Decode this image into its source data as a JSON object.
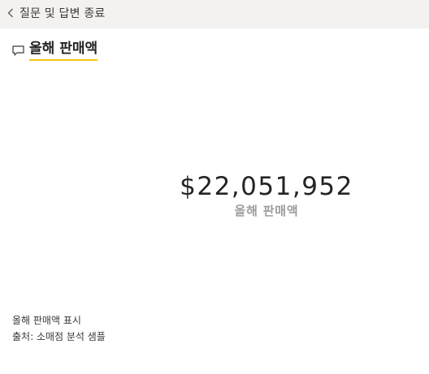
{
  "header": {
    "back_label": "질문 및 답변 종료"
  },
  "question": {
    "text": "올해 판매액"
  },
  "card": {
    "value": "$22,051,952",
    "label": "올해 판매액"
  },
  "footer": {
    "showing": "올해 판매액 표시",
    "source": "출처: 소매점 분석 샘플"
  },
  "colors": {
    "accent_underline": "#f2c811",
    "topbar_background": "#f3f2f1"
  },
  "icons": {
    "back": "chevron-left-icon",
    "question": "chat-bubble-icon"
  }
}
